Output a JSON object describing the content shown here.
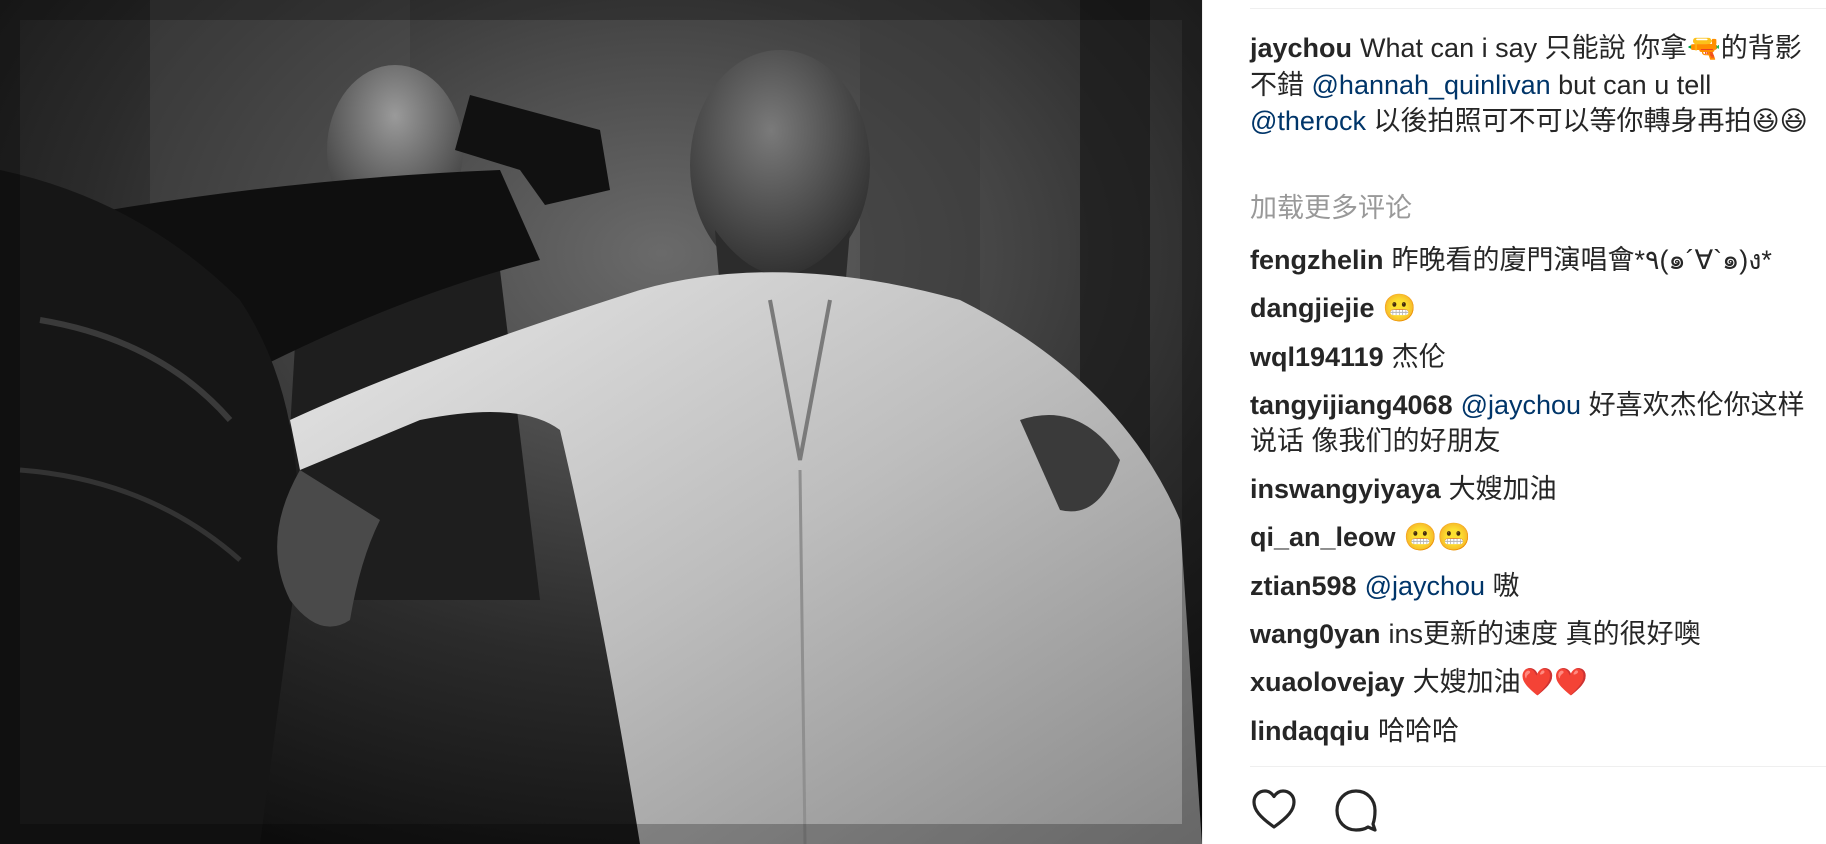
{
  "post": {
    "image_alt": "Black and white movie still of a bald man in a white shirt being restrained while another man points a gun",
    "caption": {
      "author": "jaychou",
      "parts": [
        {
          "type": "text",
          "value": "What can i say 只能說 你拿"
        },
        {
          "type": "emoji",
          "value": "🔫"
        },
        {
          "type": "text",
          "value": "的背影不錯 "
        },
        {
          "type": "mention",
          "value": "@hannah_quinlivan"
        },
        {
          "type": "text",
          "value": " but can u tell "
        },
        {
          "type": "mention",
          "value": "@therock"
        },
        {
          "type": "text",
          "value": " 以後拍照可不可以等你轉身再拍"
        },
        {
          "type": "emoji",
          "value": "😆😆"
        }
      ]
    },
    "load_more_label": "加载更多评论",
    "comments": [
      {
        "user": "fengzhelin",
        "parts": [
          {
            "type": "text",
            "value": "昨晚看的廈門演唱會*٩(๑´∀`๑)ง*"
          }
        ]
      },
      {
        "user": "dangjiejie",
        "parts": [
          {
            "type": "emoji",
            "value": "😬"
          }
        ]
      },
      {
        "user": "wql194119",
        "parts": [
          {
            "type": "text",
            "value": "杰伦"
          }
        ]
      },
      {
        "user": "tangyijiang4068",
        "parts": [
          {
            "type": "mention",
            "value": "@jaychou"
          },
          {
            "type": "text",
            "value": " 好喜欢杰伦你这样说话 像我们的好朋友"
          }
        ]
      },
      {
        "user": "inswangyiyaya",
        "parts": [
          {
            "type": "text",
            "value": "大嫂加油"
          }
        ]
      },
      {
        "user": "qi_an_leow",
        "parts": [
          {
            "type": "emoji",
            "value": "😬😬"
          }
        ]
      },
      {
        "user": "ztian598",
        "parts": [
          {
            "type": "mention",
            "value": "@jaychou"
          },
          {
            "type": "text",
            "value": " 嗷"
          }
        ]
      },
      {
        "user": "wang0yan",
        "parts": [
          {
            "type": "text",
            "value": "ins更新的速度 真的很好噢"
          }
        ]
      },
      {
        "user": "xuaolovejay",
        "parts": [
          {
            "type": "text",
            "value": "大嫂加油"
          },
          {
            "type": "emoji",
            "value": "❤️❤️"
          }
        ]
      },
      {
        "user": "lindaqqiu",
        "parts": [
          {
            "type": "text",
            "value": "哈哈哈"
          }
        ]
      }
    ],
    "actions": {
      "like_icon": "heart-outline-icon",
      "comment_icon": "speech-bubble-icon"
    }
  },
  "colors": {
    "text": "#262626",
    "mention": "#003569",
    "muted": "#999999",
    "divider": "#efefef"
  }
}
